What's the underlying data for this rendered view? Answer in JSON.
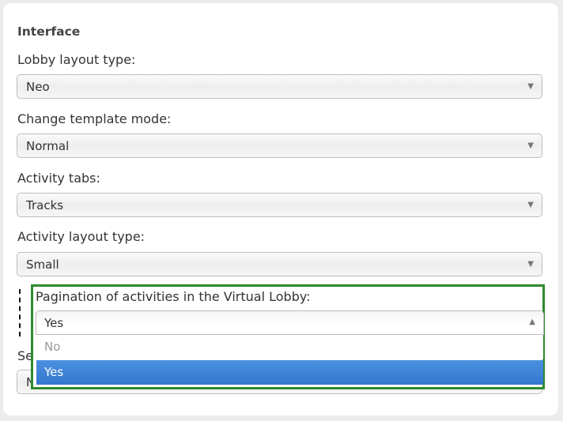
{
  "section": {
    "title": "Interface"
  },
  "fields": [
    {
      "label": "Lobby layout type:",
      "value": "Neo"
    },
    {
      "label": "Change template mode:",
      "value": "Normal"
    },
    {
      "label": "Activity tabs:",
      "value": "Tracks"
    },
    {
      "label": "Activity layout type:",
      "value": "Small"
    }
  ],
  "pagination": {
    "label": "Pagination of activities in the Virtual Lobby:",
    "value": "Yes",
    "options": [
      {
        "label": "No",
        "selected": false
      },
      {
        "label": "Yes",
        "selected": true
      }
    ]
  },
  "hidden_field": {
    "label_partial": "Se",
    "value_partial": "N"
  },
  "icons": {
    "dropdown_closed": "▼",
    "dropdown_open": "▲"
  },
  "colors": {
    "highlight": "#2e8b2e",
    "selected_option": "#3f86da"
  }
}
